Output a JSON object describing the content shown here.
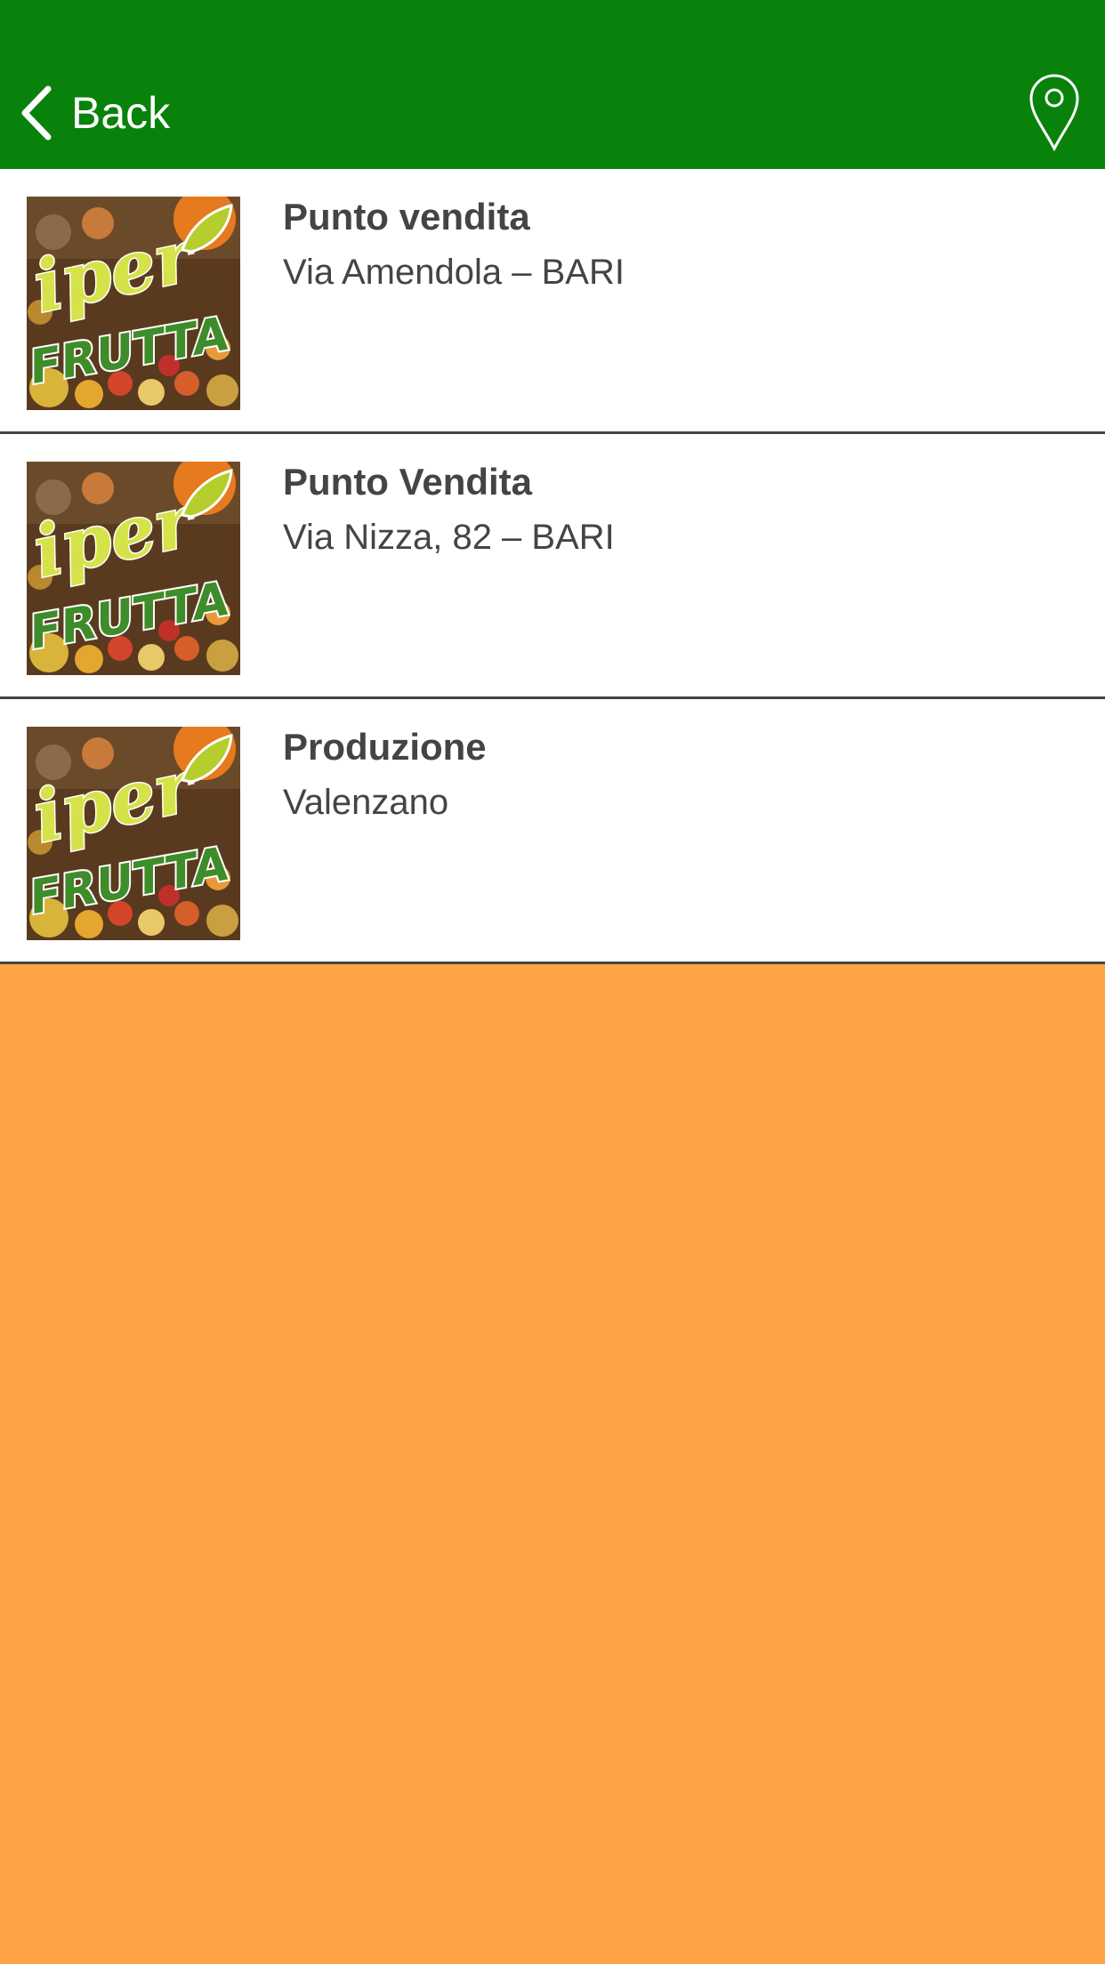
{
  "nav": {
    "back_label": "Back",
    "background": "#09820C",
    "map_icon": "map-pin-icon"
  },
  "thumbnail": {
    "logo_line1": "iper",
    "logo_line2": "FRUTTA"
  },
  "locations": [
    {
      "title": "Punto vendita",
      "subtitle": "Via Amendola – BARI"
    },
    {
      "title": "Punto Vendita",
      "subtitle": "Via Nizza, 82 – BARI"
    },
    {
      "title": "Produzione",
      "subtitle": "Valenzano"
    }
  ],
  "colors": {
    "page_background": "#FEA346",
    "row_text": "#444444",
    "divider": "#444444"
  }
}
